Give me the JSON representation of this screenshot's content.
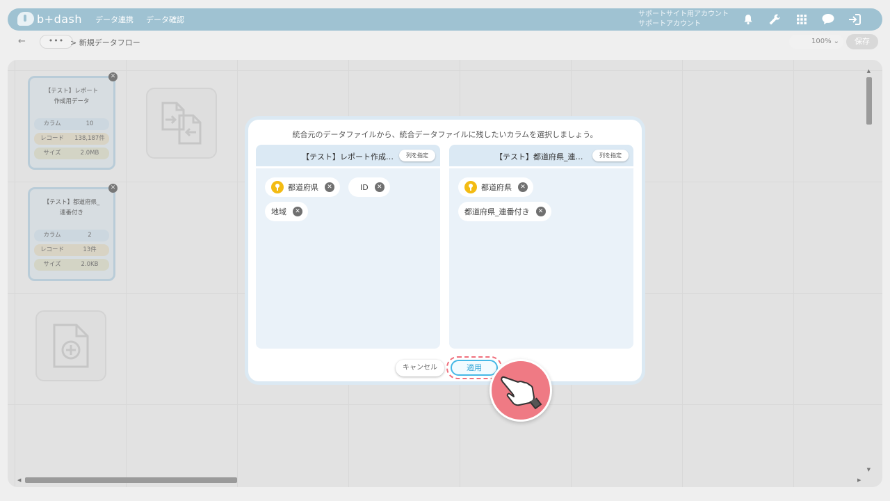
{
  "header": {
    "logo_text": "b+dash",
    "nav": [
      "データ連携",
      "データ確認"
    ],
    "account_line1": "サポートサイト用アカウント",
    "account_line2": "サポートアカウント",
    "icons": [
      "bell-icon",
      "wrench-icon",
      "grid-icon",
      "chat-icon",
      "logout-icon"
    ],
    "color": "#9fc2d2"
  },
  "subbar": {
    "back": "←",
    "more": "•••",
    "breadcrumb": "> 新規データフロー",
    "zoom": "100%",
    "save": "保存"
  },
  "canvas": {
    "files": [
      {
        "title": "【テスト】レポート作成用データ",
        "stats": [
          {
            "label": "カラム",
            "value": "10"
          },
          {
            "label": "レコード",
            "value": "138,187件"
          },
          {
            "label": "サイズ",
            "value": "2.0MB"
          }
        ]
      },
      {
        "title": "【テスト】都道府県_連番付き",
        "stats": [
          {
            "label": "カラム",
            "value": "2"
          },
          {
            "label": "レコード",
            "value": "13件"
          },
          {
            "label": "サイズ",
            "value": "2.0KB"
          }
        ]
      }
    ]
  },
  "modal": {
    "message": "統合元のデータファイルから、統合データファイルに残したいカラムを選択しましょう。",
    "left_panel": {
      "title": "【テスト】レポート作成…",
      "button": "列を指定",
      "chips": [
        {
          "label": "都道府県",
          "key": true
        },
        {
          "label": "ID",
          "key": false
        },
        {
          "label": "地域",
          "key": false
        }
      ]
    },
    "right_panel": {
      "title": "【テスト】都道府県_連…",
      "button": "列を指定",
      "chips": [
        {
          "label": "都道府県",
          "key": true
        },
        {
          "label": "都道府県_連番付き",
          "key": false
        }
      ]
    },
    "cancel": "キャンセル",
    "apply": "適用"
  },
  "colors": {
    "accent": "#45b8e6",
    "highlight": "#ef6f7c",
    "key": "#f3bb13"
  }
}
